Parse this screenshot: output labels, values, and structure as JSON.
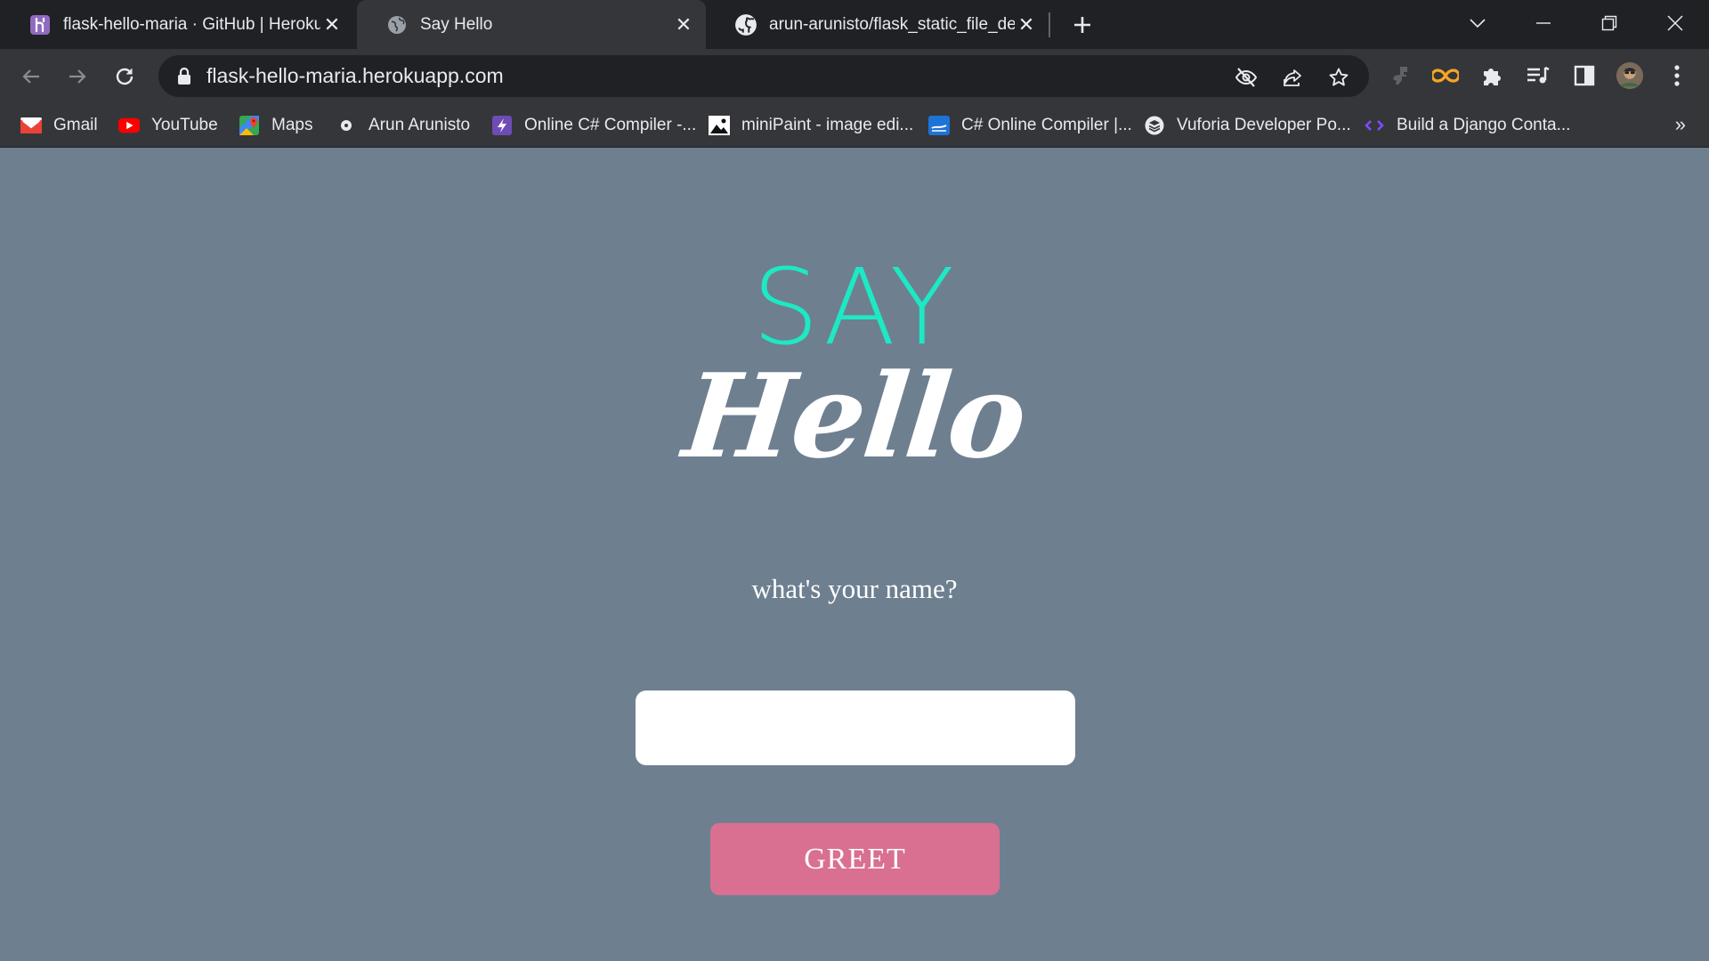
{
  "tabs": [
    {
      "title": "flask-hello-maria · GitHub | Heroku",
      "favicon": "heroku-icon",
      "active": false
    },
    {
      "title": "Say Hello",
      "favicon": "globe-icon",
      "active": true
    },
    {
      "title": "arun-arunisto/flask_static_file_deplo",
      "favicon": "github-icon",
      "active": false
    }
  ],
  "toolbar": {
    "url": "flask-hello-maria.herokuapp.com"
  },
  "bookmarks": [
    {
      "label": "Gmail",
      "icon": "gmail-icon"
    },
    {
      "label": "YouTube",
      "icon": "youtube-icon"
    },
    {
      "label": "Maps",
      "icon": "maps-icon"
    },
    {
      "label": "Arun Arunisto",
      "icon": "dot-icon"
    },
    {
      "label": "Online C# Compiler -...",
      "icon": "bolt-icon"
    },
    {
      "label": "miniPaint - image edi...",
      "icon": "image-icon"
    },
    {
      "label": "C# Online Compiler |...",
      "icon": "compiler-icon"
    },
    {
      "label": "Vuforia Developer Po...",
      "icon": "vuforia-icon"
    },
    {
      "label": "Build a Django Conta...",
      "icon": "code-icon"
    }
  ],
  "page": {
    "say": "SAY",
    "hello": "Hello",
    "question": "what's your name?",
    "input_value": "",
    "button_label": "GREET"
  },
  "colors": {
    "page_bg": "#6e7f90",
    "say_accent": "#1de9c4",
    "button_bg": "#d97091"
  }
}
